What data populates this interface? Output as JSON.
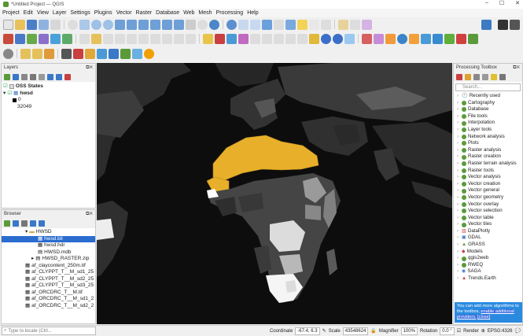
{
  "window": {
    "title": "*Untitled Project — QGIS"
  },
  "menu": [
    "Project",
    "Edit",
    "View",
    "Layer",
    "Settings",
    "Plugins",
    "Vector",
    "Raster",
    "Database",
    "Web",
    "Mesh",
    "Processing",
    "Help"
  ],
  "layers_panel": {
    "title": "Layers",
    "items": [
      {
        "label": "OSS States"
      },
      {
        "label": "hwsd"
      },
      {
        "label": "0"
      },
      {
        "label": "32049"
      }
    ]
  },
  "browser_panel": {
    "title": "Browser",
    "items": [
      "HWSD",
      "hwsd.bil",
      "hwsd.hdr",
      "HWSD.mdb",
      "HWSD_RASTER.zip",
      "af_claycontent_250m.tif",
      "af_CLYPPT_T__M_sd1_25",
      "af_CLYPPT_T__M_sd2_25",
      "af_CLYPPT_T__M_sd3_25",
      "af_ORCDRC_T__M.tif",
      "af_ORCDRC_T__M_sd1_2",
      "af_ORCDRC_T__M_sd2_2"
    ]
  },
  "toolbox": {
    "title": "Processing Toolbox",
    "search_placeholder": "Search...",
    "items": [
      "Recently used",
      "Cartography",
      "Database",
      "File tools",
      "Interpolation",
      "Layer tools",
      "Network analysis",
      "Plots",
      "Raster analysis",
      "Raster creation",
      "Raster terrain analysis",
      "Raster tools",
      "Vector analysis",
      "Vector creation",
      "Vector general",
      "Vector geometry",
      "Vector overlay",
      "Vector selection",
      "Vector table",
      "Vector tiles",
      "DataPlotly",
      "GDAL",
      "GRASS",
      "Models",
      "qgis2web",
      "RWEQ",
      "SAGA",
      "Trends.Earth"
    ],
    "notice_text": "You can add more algorithms to the toolbox,",
    "notice_link": "enable additional providers.",
    "notice_close": "[close]"
  },
  "status": {
    "locate_placeholder": "Type to locate (Ctrl...",
    "coordinate_label": "Coordinate",
    "coordinate": "-67.4, 6.3",
    "scale_label": "Scale",
    "scale": "43548624",
    "magnifier_label": "Magnifier",
    "magnifier": "100%",
    "rotation_label": "Rotation",
    "rotation": "0.0 °",
    "render": "Render",
    "crs": "EPSG:4326"
  },
  "colors": {
    "highlight": "#e8b02a",
    "selection": "#2b6ccf",
    "qgis_green": "#589632"
  }
}
